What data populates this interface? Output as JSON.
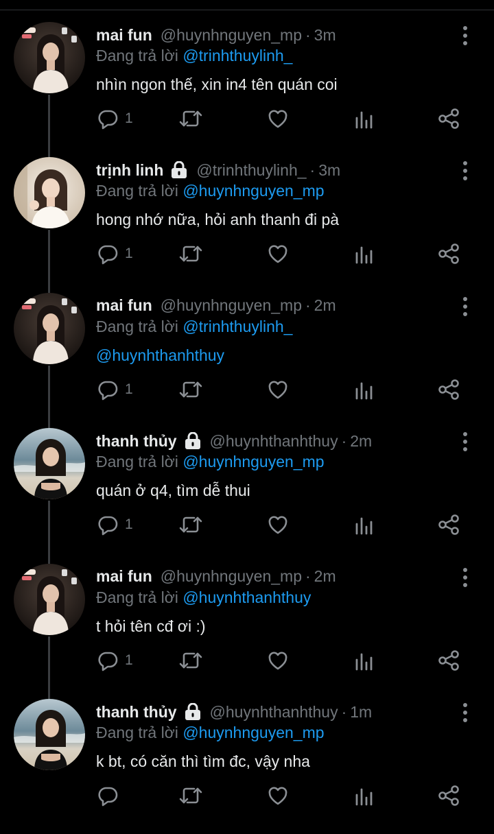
{
  "thread": [
    {
      "name": "mai fun",
      "locked": false,
      "handle": "@huynhnguyen_mp",
      "time": "3m",
      "reply_prefix": "Đang trả lời",
      "reply_to": "@trinhthuylinh_",
      "text": "nhìn ngon thế, xin in4 tên quán coi",
      "text_is_mention": false,
      "reply_count": "1",
      "avatar": "avatar-mai"
    },
    {
      "name": "trịnh linh",
      "locked": true,
      "handle": "@trinhthuylinh_",
      "time": "3m",
      "reply_prefix": "Đang trả lời",
      "reply_to": "@huynhnguyen_mp",
      "text": "hong nhớ nữa, hỏi anh thanh đi pà",
      "text_is_mention": false,
      "reply_count": "1",
      "avatar": "avatar-linh"
    },
    {
      "name": "mai fun",
      "locked": false,
      "handle": "@huynhnguyen_mp",
      "time": "2m",
      "reply_prefix": "Đang trả lời",
      "reply_to": "@trinhthuylinh_",
      "text": "@huynhthanhthuy",
      "text_is_mention": true,
      "reply_count": "1",
      "avatar": "avatar-mai"
    },
    {
      "name": "thanh thủy",
      "locked": true,
      "handle": "@huynhthanhthuy",
      "time": "2m",
      "reply_prefix": "Đang trả lời",
      "reply_to": "@huynhnguyen_mp",
      "text": "quán ở q4, tìm dễ thui",
      "text_is_mention": false,
      "reply_count": "1",
      "avatar": "avatar-thuy"
    },
    {
      "name": "mai fun",
      "locked": false,
      "handle": "@huynhnguyen_mp",
      "time": "2m",
      "reply_prefix": "Đang trả lời",
      "reply_to": "@huynhthanhthuy",
      "text": "t hỏi tên cđ ơi :)",
      "text_is_mention": false,
      "reply_count": "1",
      "avatar": "avatar-mai"
    },
    {
      "name": "thanh thủy",
      "locked": true,
      "handle": "@huynhthanhthuy",
      "time": "1m",
      "reply_prefix": "Đang trả lời",
      "reply_to": "@huynhnguyen_mp",
      "text": "k bt, có căn thì tìm đc, vậy nha",
      "text_is_mention": false,
      "reply_count": "",
      "avatar": "avatar-thuy"
    }
  ],
  "separator": "·",
  "icons": {
    "reply": "reply-icon",
    "retweet": "retweet-icon",
    "like": "heart-icon",
    "views": "views-icon",
    "share": "share-icon",
    "more": "more-icon",
    "lock": "lock-icon"
  },
  "colors": {
    "background": "#000000",
    "text": "#e7e9ea",
    "muted": "#71767b",
    "link": "#1d9bf0",
    "thread_line": "#3a3d40"
  }
}
